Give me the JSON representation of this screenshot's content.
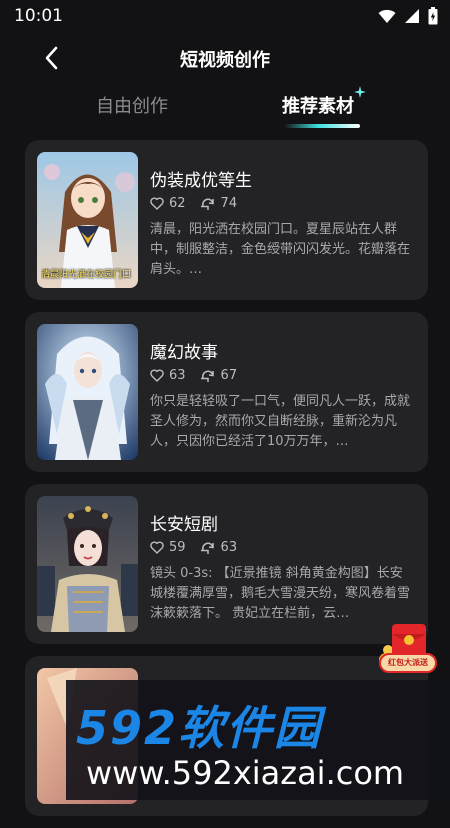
{
  "status": {
    "time": "10:01"
  },
  "header": {
    "title": "短视频创作"
  },
  "tabs": [
    {
      "label": "自由创作",
      "active": false
    },
    {
      "label": "推荐素材",
      "active": true
    }
  ],
  "cards": [
    {
      "title": "伪装成优等生",
      "likes": "62",
      "uses": "74",
      "desc": "清晨，阳光洒在校园门口。夏星辰站在人群中，制服整洁，金色绶带闪闪发光。花瓣落在肩头。…",
      "thumb_caption": "清晨阳光洒在校园门口"
    },
    {
      "title": "魔幻故事",
      "likes": "63",
      "uses": "67",
      "desc": "你只是轻轻吸了一口气，便同凡人一跃，成就圣人修为，然而你又自断经脉，重新沦为凡人，只因你已经活了10万万年，…"
    },
    {
      "title": "长安短剧",
      "likes": "59",
      "uses": "63",
      "desc": "镜头 0-3s: 【近景推镜 斜角黄金构图】长安城楼覆满厚雪，鹅毛大雪漫天纷，寒风卷着雪沫簌簌落下。 贵妃立在栏前，云…"
    },
    {
      "title": "",
      "likes": "",
      "uses": "",
      "desc": ""
    }
  ],
  "badge": {
    "label": "红包大派送"
  },
  "watermark": {
    "line1": "592软件园",
    "line2": "www.592xiazai.com"
  },
  "colors": {
    "accent": "#3fe0dc",
    "card": "#232326",
    "background": "#121214",
    "watermark": "#1b86e6"
  }
}
